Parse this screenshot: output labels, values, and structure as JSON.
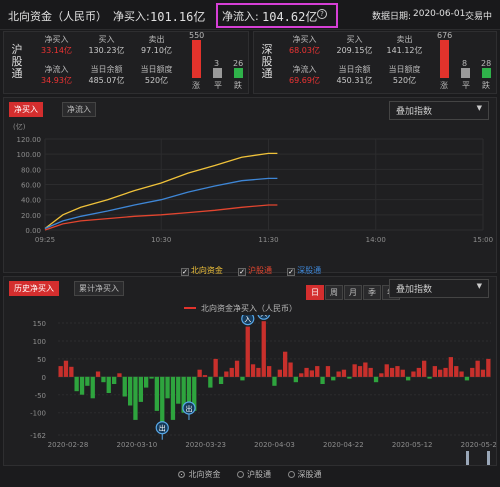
{
  "header": {
    "title": "北向资金（人民币）",
    "net_buy_label": "净买入:",
    "net_buy_value": "101.16亿",
    "net_inflow_label": "净流入:",
    "net_inflow_value": "104.62亿",
    "help_icon": "question-circle-icon",
    "date_label": "数据日期:",
    "date_value": "2020-06-01",
    "trade_time_label": "交易中"
  },
  "hgt": {
    "name": "沪股通",
    "net_buy_label": "净买入",
    "net_buy": "33.14亿",
    "buy_label": "买入",
    "buy": "130.23亿",
    "sell_label": "卖出",
    "sell": "97.10亿",
    "net_inflow_label": "净流入",
    "net_inflow": "34.93亿",
    "balance_label": "当日余额",
    "balance": "485.07亿",
    "quota_label": "当日额度",
    "quota": "520亿",
    "up_count": "550",
    "flat_count": "3",
    "down_count": "26",
    "up_label": "涨",
    "flat_label": "平",
    "down_label": "跌"
  },
  "sgt": {
    "name": "深股通",
    "net_buy_label": "净买入",
    "net_buy": "68.03亿",
    "buy_label": "买入",
    "buy": "209.15亿",
    "sell_label": "卖出",
    "sell": "141.12亿",
    "net_inflow_label": "净流入",
    "net_inflow": "69.69亿",
    "balance_label": "当日余额",
    "balance": "450.31亿",
    "quota_label": "当日额度",
    "quota": "520亿",
    "up_count": "676",
    "flat_count": "8",
    "down_count": "28",
    "up_label": "涨",
    "flat_label": "平",
    "down_label": "跌"
  },
  "intraday": {
    "tabs": [
      "净买入",
      "净流入"
    ],
    "overlay_select": "叠加指数",
    "unit": "(亿)",
    "legend": [
      "北向资金",
      "沪股通",
      "深股通"
    ],
    "colors": {
      "north": "#f0c23a",
      "hgt": "#e2452f",
      "sgt": "#3e86d6"
    }
  },
  "history": {
    "tabs": [
      "历史净买入",
      "累计净买入"
    ],
    "periods": [
      "日",
      "周",
      "月",
      "季",
      "年"
    ],
    "overlay_select": "叠加指数",
    "series_title": "北向资金净买入（人民币）",
    "markers": {
      "out": "出",
      "in": "入"
    },
    "radios": [
      "北向资金",
      "沪股通",
      "深股通"
    ]
  },
  "chart_data": [
    {
      "type": "line",
      "ylabel": "(亿)",
      "ylim": [
        0,
        120
      ],
      "yticks": [
        0,
        20,
        40,
        60,
        80,
        100,
        120
      ],
      "xticks": [
        "09:25",
        "10:30",
        "11:30",
        "14:00",
        "15:00"
      ],
      "series": [
        {
          "name": "北向资金",
          "x": [
            "09:25",
            "09:35",
            "09:45",
            "10:00",
            "10:15",
            "10:30",
            "10:45",
            "11:00",
            "11:15",
            "11:30",
            "11:35"
          ],
          "values": [
            2,
            20,
            30,
            40,
            52,
            62,
            75,
            85,
            96,
            101,
            101
          ]
        },
        {
          "name": "沪股通",
          "x": [
            "09:25",
            "09:35",
            "09:45",
            "10:00",
            "10:15",
            "10:30",
            "10:45",
            "11:00",
            "11:15",
            "11:30",
            "11:35"
          ],
          "values": [
            0,
            8,
            12,
            15,
            18,
            20,
            23,
            26,
            30,
            33,
            33
          ]
        },
        {
          "name": "深股通",
          "x": [
            "09:25",
            "09:35",
            "09:45",
            "10:00",
            "10:15",
            "10:30",
            "10:45",
            "11:00",
            "11:15",
            "11:30",
            "11:35"
          ],
          "values": [
            2,
            12,
            18,
            25,
            33,
            40,
            50,
            58,
            65,
            68,
            68
          ]
        }
      ]
    },
    {
      "type": "bar",
      "title": "北向资金净买入（人民币）",
      "ylim": [
        -162,
        150
      ],
      "yticks": [
        150,
        100,
        50,
        0,
        -50,
        -100,
        -162
      ],
      "xticks": [
        "2020-02-28",
        "2020-03-10",
        "2020-03-23",
        "2020-04-03",
        "2020-04-22",
        "2020-05-12",
        "2020-05-25"
      ],
      "values": [
        30,
        45,
        28,
        -40,
        -50,
        -25,
        -60,
        15,
        -15,
        -45,
        -20,
        10,
        -55,
        -80,
        -120,
        -70,
        -30,
        -5,
        -95,
        -125,
        -60,
        -120,
        -75,
        -100,
        -70,
        -95,
        20,
        5,
        -30,
        50,
        -20,
        15,
        25,
        45,
        -10,
        140,
        35,
        25,
        155,
        30,
        -25,
        20,
        70,
        40,
        -15,
        10,
        25,
        18,
        30,
        -20,
        30,
        -10,
        15,
        20,
        -5,
        35,
        30,
        40,
        25,
        -15,
        10,
        35,
        25,
        30,
        20,
        -10,
        15,
        25,
        45,
        -5,
        30,
        20,
        25,
        55,
        30,
        15,
        -10,
        25,
        45,
        20,
        50
      ]
    }
  ]
}
